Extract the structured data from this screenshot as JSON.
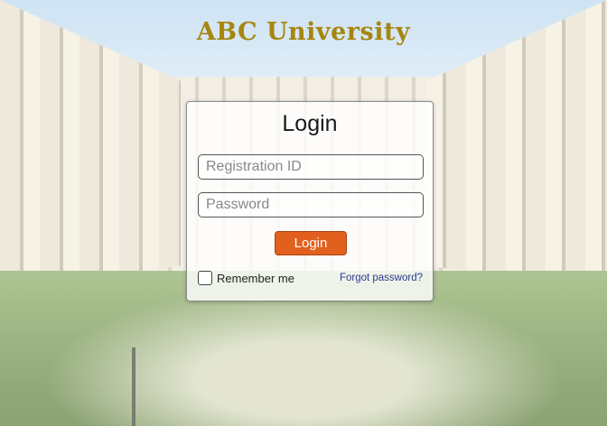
{
  "brand": {
    "title": "ABC University"
  },
  "login": {
    "heading": "Login",
    "registration_id": {
      "value": "",
      "placeholder": "Registration ID"
    },
    "password": {
      "value": "",
      "placeholder": "Password"
    },
    "submit_label": "Login",
    "remember_label": "Remember me",
    "remember_checked": false,
    "forgot_label": "Forgot password?"
  },
  "colors": {
    "brand_text": "#a7860f",
    "login_button": "#e2601d",
    "link": "#2a3b8f"
  }
}
